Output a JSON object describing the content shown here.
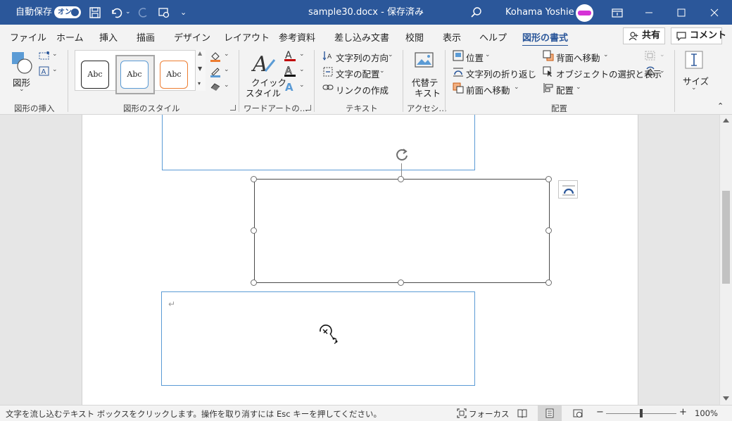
{
  "titlebar": {
    "autosave_label": "自動保存",
    "autosave_toggle": "オン",
    "doc_title": "sample30.docx - 保存済み",
    "doc_title_chevron": "⌄",
    "user_name": "Kohama Yoshie"
  },
  "tabs": [
    "ファイル",
    "ホーム",
    "挿入",
    "描画",
    "デザイン",
    "レイアウト",
    "参考資料",
    "差し込み文書",
    "校閲",
    "表示",
    "ヘルプ",
    "図形の書式"
  ],
  "active_tab": "図形の書式",
  "top_buttons": {
    "share": "共有",
    "comment": "コメント"
  },
  "ribbon": {
    "insert_shapes": {
      "label": "図形の挿入",
      "shape_button": "図形"
    },
    "shape_styles": {
      "label": "図形のスタイル",
      "samples": [
        "Abc",
        "Abc",
        "Abc"
      ]
    },
    "wordart": {
      "label": "ワードアートの…",
      "quick_style_line1": "クイック",
      "quick_style_line2": "スタイル"
    },
    "text": {
      "label": "テキスト",
      "direction": "文字列の方向",
      "align": "文字の配置",
      "link": "リンクの作成"
    },
    "accessibility": {
      "label": "アクセシ…",
      "alt_line1": "代替テ",
      "alt_line2": "キスト"
    },
    "arrange": {
      "label": "配置",
      "position": "位置",
      "wrap": "文字列の折り返し",
      "forward": "前面へ移動",
      "backward": "背面へ移動",
      "selection": "オブジェクトの選択と表示",
      "align": "配置"
    },
    "size": {
      "label": "サイズ"
    }
  },
  "document": {
    "paragraph_mark": "↵"
  },
  "statusbar": {
    "message": "文字を流し込むテキスト ボックスをクリックします。操作を取り消すには Esc キーを押してください。",
    "focus": "フォーカス",
    "zoom": "100%",
    "zoom_minus": "−",
    "zoom_plus": "+"
  },
  "colors": {
    "titlebar_bg": "#2b579a",
    "accent": "#2b579a",
    "textbox_border": "#5b9bd5"
  }
}
